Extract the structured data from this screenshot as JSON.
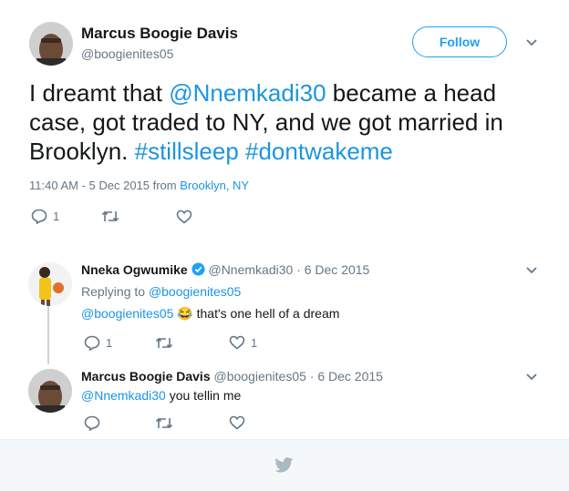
{
  "main_tweet": {
    "author_name": "Marcus Boogie Davis",
    "author_handle": "@boogienites05",
    "follow_label": "Follow",
    "text_parts": {
      "p1": "I dreamt that ",
      "mention": "@Nnemkadi30",
      "p2": " became a head case, got traded to NY, and we got married in Brooklyn. ",
      "tag1": "#stillsleep",
      "space": " ",
      "tag2": "#dontwakeme"
    },
    "timestamp": "11:40 AM - 5 Dec 2015 from ",
    "location": "Brooklyn, NY",
    "reply_count": "1",
    "retweet_count": "",
    "like_count": ""
  },
  "replies": [
    {
      "author_name": "Nneka Ogwumike",
      "verified": true,
      "author_handle": "@Nnemkadi30",
      "date": "· 6 Dec 2015",
      "replying_to_label": "Replying to ",
      "replying_to_handle": "@boogienites05",
      "mention": "@boogienites05",
      "emoji": "😂",
      "text": " that's one hell of a dream",
      "reply_count": "1",
      "like_count": "1"
    },
    {
      "author_name": "Marcus Boogie Davis",
      "author_handle": "@boogienites05",
      "date": "· 6 Dec 2015",
      "mention": "@Nnemkadi30",
      "text": " you tellin me",
      "reply_count": "",
      "like_count": ""
    }
  ],
  "icons": {
    "reply": "reply-icon",
    "retweet": "retweet-icon",
    "like": "heart-icon",
    "more": "chevron-down-icon",
    "verified": "verified-badge-icon",
    "footer": "twitter-bird-icon"
  },
  "colors": {
    "link": "#1b95e0",
    "muted": "#657786",
    "follow": "#1da1f2",
    "footer_bg": "#f5f8fa"
  }
}
